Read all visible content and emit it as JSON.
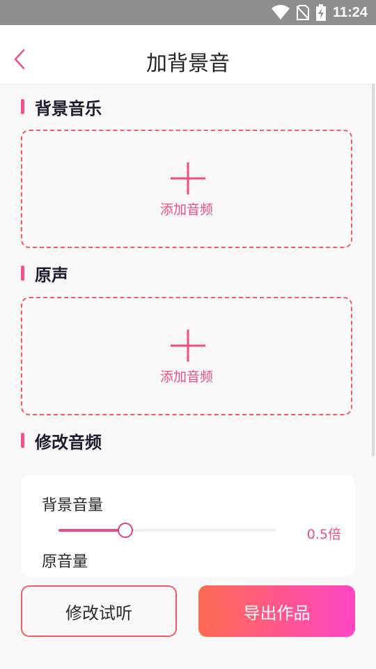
{
  "status_bar": {
    "time": "11:24",
    "icons": [
      "wifi-icon",
      "no-sim-icon",
      "battery-charging-icon"
    ]
  },
  "header": {
    "title": "加背景音",
    "back_icon": "chevron-left-icon"
  },
  "sections": {
    "background_music": {
      "title": "背景音乐",
      "add_label": "添加音频"
    },
    "original_sound": {
      "title": "原声",
      "add_label": "添加音频"
    },
    "modify_audio": {
      "title": "修改音频"
    }
  },
  "volume": {
    "background_label": "背景音量",
    "background_value": "0.5倍",
    "background_level": 0.3,
    "original_label": "原音量"
  },
  "actions": {
    "preview_label": "修改试听",
    "export_label": "导出作品"
  },
  "colors": {
    "accent": "#ec4d86",
    "dashed_border": "#f05a6e",
    "gradient_start": "#ff6a52",
    "gradient_end": "#ff45c4"
  }
}
